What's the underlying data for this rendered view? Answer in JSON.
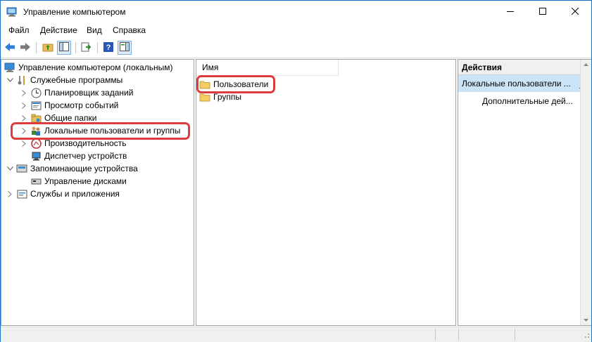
{
  "window": {
    "title": "Управление компьютером",
    "controls": {
      "minimize": "minimize",
      "maximize": "maximize",
      "close": "close"
    }
  },
  "menu": [
    "Файл",
    "Действие",
    "Вид",
    "Справка"
  ],
  "tree": {
    "root": "Управление компьютером (локальным)",
    "system_tools": "Служебные программы",
    "task_scheduler": "Планировщик заданий",
    "event_viewer": "Просмотр событий",
    "shared_folders": "Общие папки",
    "local_users": "Локальные пользователи и группы",
    "performance": "Производительность",
    "device_manager": "Диспетчер устройств",
    "storage": "Запоминающие устройства",
    "disk_management": "Управление дисками",
    "services_apps": "Службы и приложения"
  },
  "list": {
    "column_name": "Имя",
    "items": [
      "Пользователи",
      "Группы"
    ]
  },
  "actions": {
    "title": "Действия",
    "selected_group": "Локальные пользователи ...",
    "more_actions": "Дополнительные дей..."
  },
  "colors": {
    "accent_highlight": "#dc3c3c",
    "selection": "#cce4f7",
    "window_border": "#1a73c8"
  }
}
